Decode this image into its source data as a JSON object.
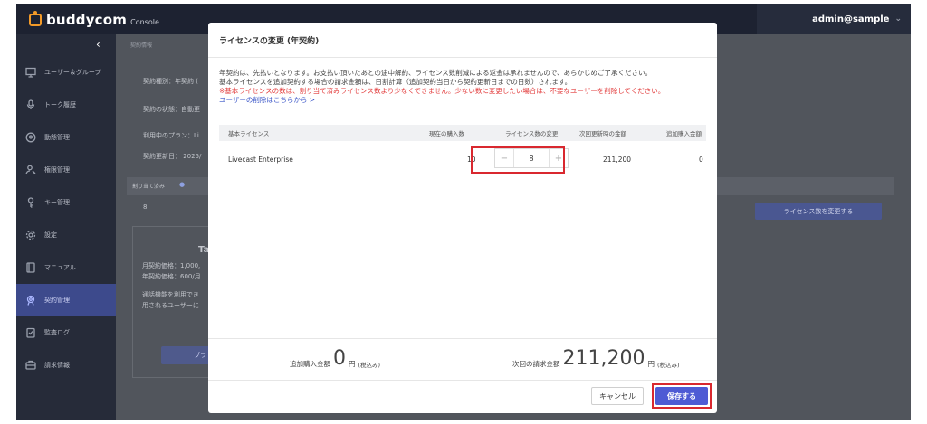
{
  "header": {
    "logo_text": "buddycom",
    "logo_sub": "Console",
    "user": "admin@sample",
    "brand_color": "#f39a28"
  },
  "sidebar": {
    "collapse_icon": "chevron-left-icon",
    "items": [
      {
        "label": "ユーザー＆グループ",
        "icon": "monitor-icon",
        "active": false
      },
      {
        "label": "トーク履歴",
        "icon": "microphone-icon",
        "active": false
      },
      {
        "label": "動態管理",
        "icon": "location-pin-icon",
        "active": false
      },
      {
        "label": "権限管理",
        "icon": "user-key-icon",
        "active": false
      },
      {
        "label": "キー管理",
        "icon": "key-icon",
        "active": false
      },
      {
        "label": "設定",
        "icon": "gear-icon",
        "active": false
      },
      {
        "label": "マニュアル",
        "icon": "book-icon",
        "active": false
      },
      {
        "label": "契約管理",
        "icon": "contract-icon",
        "active": true
      },
      {
        "label": "監査ログ",
        "icon": "clipboard-icon",
        "active": false
      },
      {
        "label": "請求情報",
        "icon": "billing-icon",
        "active": false
      }
    ]
  },
  "background": {
    "breadcrumb": "契約情報",
    "contract_type": "契約種別：年契約 (",
    "contract_status": "契約の状態：自動更",
    "plan": "利用中のプラン：Li",
    "renewal": "契約更新日： 2025/",
    "assigned_label": "割り当て済み",
    "assigned_value": "8",
    "plan_letter": "Ta",
    "monthly_price": "月契約価格：1,000,",
    "yearly_price": "年契約価格：600/月",
    "call_note_1": "通話機能を利用でき",
    "call_note_2": "用されるユーザーに",
    "left_button_label": "プラ",
    "change_license_button": "ライセンス数を変更する"
  },
  "modal": {
    "title": "ライセンスの変更 (年契約)",
    "notice_line1": "年契約は、先払いとなります。お支払い頂いたあとの途中解約、ライセンス数削減による返金は承れませんので、あらかじめご了承ください。",
    "notice_line2": "基本ライセンスを追加契約する場合の請求金額は、日割計算（追加契約当日から契約更新日までの日数）されます。",
    "notice_warning": "※基本ライセンスの数は、割り当て済みライセンス数より少なくできません。少ない数に変更したい場合は、不要なユーザーを削除してください。",
    "notice_link": "ユーザーの削除はこちらから >",
    "table": {
      "headers": [
        "基本ライセンス",
        "現在の購入数",
        "ライセンス数の変更",
        "次回更新時の金額",
        "追加購入金額"
      ],
      "row": {
        "name": "Livecast Enterprise",
        "current": "10",
        "new_count": "8",
        "renewal_amount": "211,200",
        "additional_amount": "0"
      },
      "minus_symbol": "−",
      "plus_symbol": "+"
    },
    "totals": {
      "additional_label": "追加購入金額",
      "additional_value": "0",
      "additional_unit": "円",
      "additional_tax": "(税込み)",
      "next_label": "次回の請求金額",
      "next_value": "211,200",
      "next_unit": "円",
      "next_tax": "(税込み)"
    },
    "cancel_label": "キャンセル",
    "save_label": "保存する",
    "highlight_color": "#d9282f"
  }
}
